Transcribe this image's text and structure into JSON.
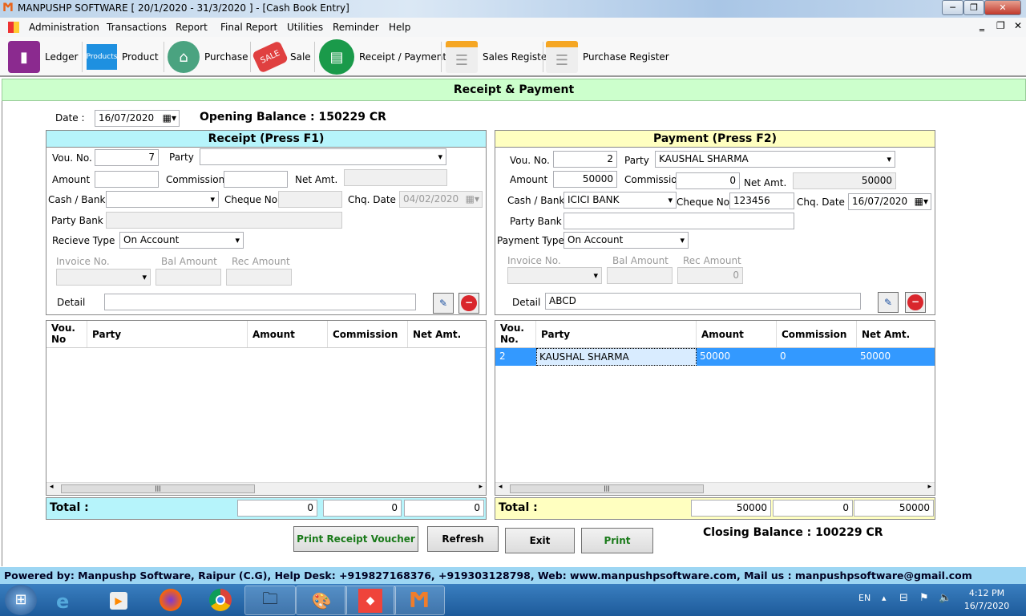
{
  "window": {
    "title": "MANPUSHP SOFTWARE [ 20/1/2020 - 31/3/2020 ]   - [Cash Book Entry]"
  },
  "menu": [
    "Administration",
    "Transactions",
    "Report",
    "Final Report",
    "Utilities",
    "Reminder",
    "Help"
  ],
  "toolbar": [
    {
      "label": "Ledger",
      "icon": "ledger-book-icon",
      "color": "#8b2a8f"
    },
    {
      "label": "Product",
      "icon": "products-icon",
      "color": "#1e90e0",
      "icon_text": "Products"
    },
    {
      "label": "Purchase",
      "icon": "basket-icon",
      "color": "#4aa380"
    },
    {
      "label": "Sale",
      "icon": "sale-tag-icon",
      "color": "#e04040",
      "icon_text": "SALE"
    },
    {
      "label": "Receipt / Payment",
      "icon": "receipt-icon",
      "color": "#1a9a4a"
    },
    {
      "label": "Sales Register",
      "icon": "register-icon",
      "color": "#e8e8e8"
    },
    {
      "label": "Purchase Register",
      "icon": "register-icon",
      "color": "#e8e8e8"
    }
  ],
  "header": "Receipt & Payment",
  "date_label": "Date :",
  "date": "16/07/2020",
  "opening_balance": "Opening Balance : 150229 CR",
  "closing_balance": "Closing Balance : 100229 CR",
  "receipt": {
    "title": "Receipt (Press F1)",
    "vou_label": "Vou. No.",
    "vou": "7",
    "party_label": "Party",
    "party": "",
    "amount_label": "Amount",
    "amount": "",
    "commission_label": "Commission",
    "commission": "",
    "net_label": "Net Amt.",
    "net": "",
    "cash_label": "Cash / Bank",
    "cash": "",
    "cheque_label": "Cheque No",
    "cheque": "",
    "chq_date_label": "Chq.  Date",
    "chq_date": "04/02/2020",
    "party_bank_label": "Party Bank",
    "party_bank": "",
    "type_label": "Recieve Type",
    "type": "On Account",
    "invoice_label": "Invoice No.",
    "bal_label": "Bal Amount",
    "rec_label": "Rec Amount",
    "rec_amount": "",
    "detail_label": "Detail",
    "detail": "",
    "columns": [
      "Vou. No",
      "Party",
      "Amount",
      "Commission",
      "Net Amt."
    ],
    "rows": [],
    "total_label": "Total :",
    "totals": [
      "0",
      "0",
      "0"
    ]
  },
  "payment": {
    "title": "Payment (Press F2)",
    "vou_label": "Vou. No.",
    "vou": "2",
    "party_label": "Party",
    "party": "KAUSHAL SHARMA",
    "amount_label": "Amount",
    "amount": "50000",
    "commission_label": "Commission",
    "commission": "0",
    "net_label": "Net Amt.",
    "net": "50000",
    "cash_label": "Cash / Bank",
    "cash": "ICICI BANK",
    "cheque_label": "Cheque No",
    "cheque": "123456",
    "chq_date_label": "Chq.  Date",
    "chq_date": "16/07/2020",
    "party_bank_label": "Party Bank",
    "party_bank": "",
    "type_label": "Payment Type",
    "type": "On Account",
    "invoice_label": "Invoice No.",
    "bal_label": "Bal Amount",
    "rec_label": "Rec Amount",
    "rec_amount": "0",
    "detail_label": "Detail",
    "detail": "ABCD",
    "columns": [
      "Vou. No.",
      "Party",
      "Amount",
      "Commission",
      "Net Amt."
    ],
    "rows": [
      [
        "2",
        "KAUSHAL SHARMA",
        "50000",
        "0",
        "50000"
      ]
    ],
    "total_label": "Total :",
    "totals": [
      "50000",
      "0",
      "50000"
    ]
  },
  "buttons": {
    "print_receipt": "Print Receipt Voucher",
    "refresh": "Refresh",
    "exit": "Exit",
    "print": "Print"
  },
  "footer": "Powered by: Manpushp Software, Raipur (C.G), Help Desk: +919827168376, +919303128798, Web: www.manpushpsoftware.com,  Mail us :  manpushpsoftware@gmail.com",
  "tray": {
    "lang": "EN",
    "time": "4:12 PM",
    "date": "16/7/2020"
  }
}
